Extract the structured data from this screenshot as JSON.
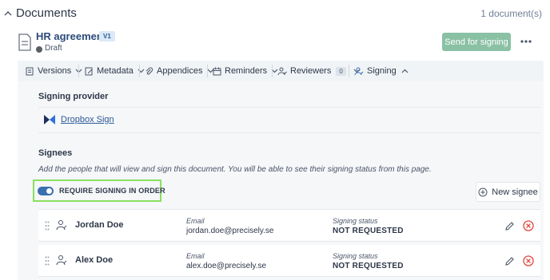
{
  "section": {
    "title": "Documents",
    "count": "1 document(s)"
  },
  "document": {
    "title": "HR agreement",
    "version": "V1",
    "status": "Draft",
    "send_label": "Send for signing"
  },
  "toolbar": {
    "versions": "Versions",
    "metadata": "Metadata",
    "appendices": "Appendices",
    "reminders": "Reminders",
    "reviewers": "Reviewers",
    "reviewers_count": "0",
    "signing": "Signing"
  },
  "signing": {
    "provider_heading": "Signing provider",
    "provider_name": "Dropbox Sign",
    "signees_heading": "Signees",
    "signees_help": "Add the people that will view and sign this document. You will be able to see their signing status from this page.",
    "order_toggle_label": "REQUIRE SIGNING IN ORDER",
    "order_toggle_on": true,
    "new_signee_label": "New signee",
    "email_label": "Email",
    "status_label": "Signing status",
    "signees": [
      {
        "name": "Jordan Doe",
        "email": "jordan.doe@precisely.se",
        "status": "NOT REQUESTED"
      },
      {
        "name": "Alex Doe",
        "email": "alex.doe@precisely.se",
        "status": "NOT REQUESTED"
      }
    ]
  },
  "colors": {
    "accent": "#3a6fb0",
    "send_button": "#8ac1a4",
    "highlight": "#88e05f",
    "remove": "#e0463d"
  }
}
